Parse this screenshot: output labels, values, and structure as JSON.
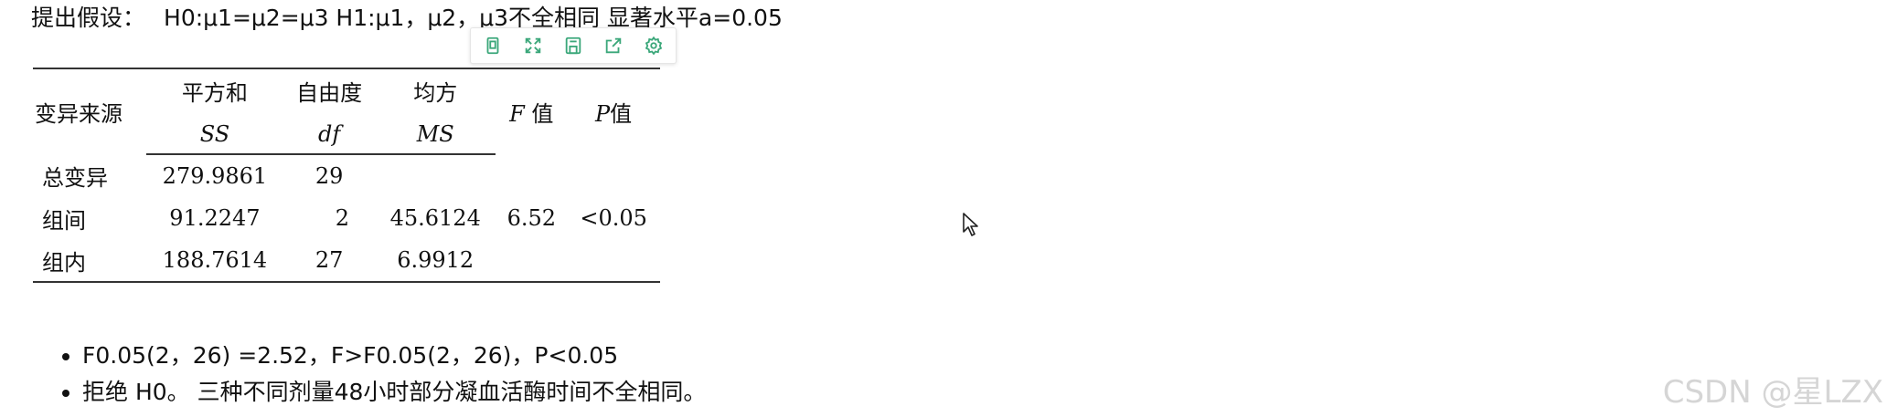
{
  "hypothesis": {
    "label": "提出假设：",
    "text": "H0:μ1=μ2=μ3 H1:μ1，μ2，μ3不全相同 显著水平a=0.05"
  },
  "toolbar": {
    "icons": [
      "copy-icon",
      "expand-icon",
      "save-icon",
      "share-icon",
      "settings-icon"
    ],
    "accent_color": "#3ba77a"
  },
  "table": {
    "headers": {
      "source": "变异来源",
      "ss": "平方和",
      "ss_sub": "SS",
      "df": "自由度",
      "df_sub": "df",
      "ms": "均方",
      "ms_sub": "MS",
      "f_italic": "F",
      "f_suffix": " 值",
      "p_italic": "P",
      "p_suffix": "值"
    },
    "rows": [
      {
        "source": "总变异",
        "ss": "279.9861",
        "df": "29",
        "ms": "",
        "f": "",
        "p": ""
      },
      {
        "source": "组间",
        "ss": "91.2247",
        "df": "2",
        "ms": "45.6124",
        "f": "6.52",
        "p": "<0.05"
      },
      {
        "source": "组内",
        "ss": "188.7614",
        "df": "27",
        "ms": "6.9912",
        "f": "",
        "p": ""
      }
    ]
  },
  "bullets": [
    "F0.05(2，26) =2.52，F>F0.05(2，26)，P<0.05",
    "拒绝 H0。 三种不同剂量48小时部分凝血活酶时间不全相同。"
  ],
  "watermark": "CSDN @星LZX"
}
